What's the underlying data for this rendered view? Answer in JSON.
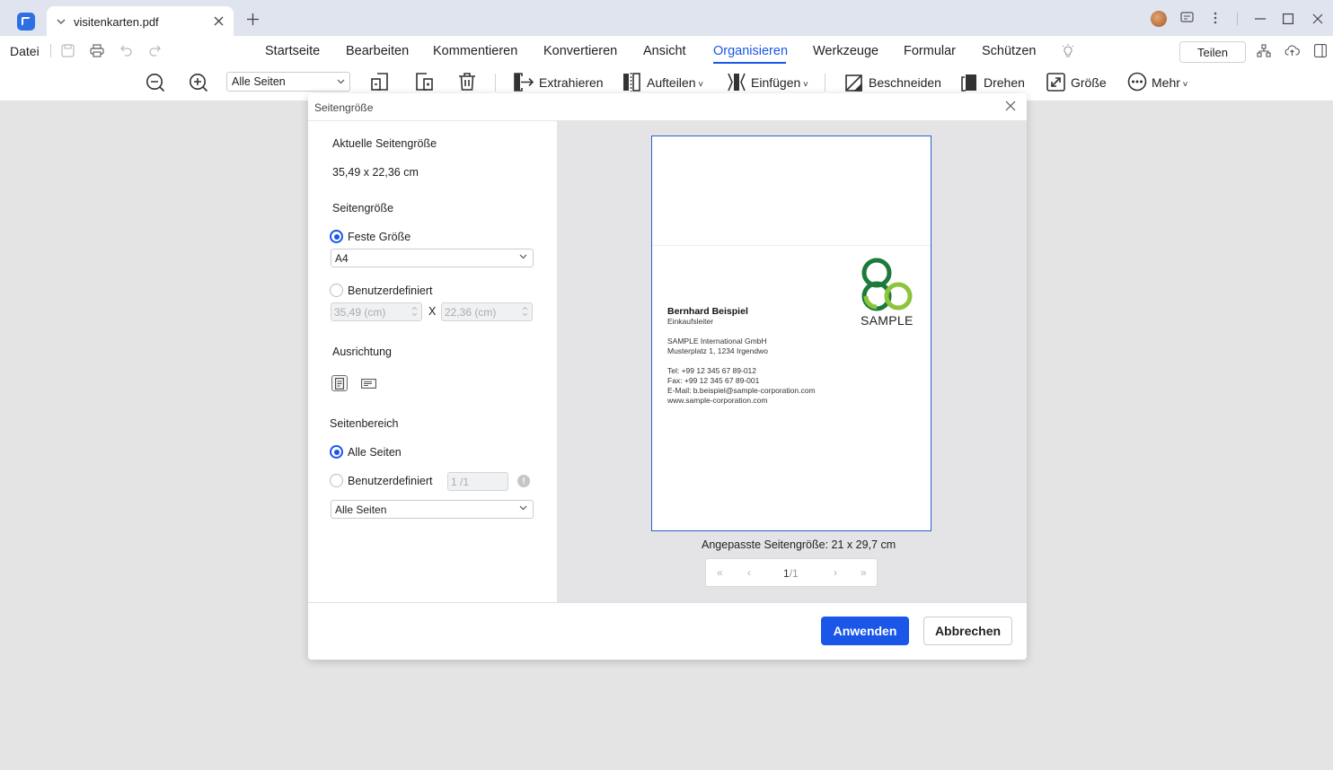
{
  "tab": {
    "title": "visitenkarten.pdf"
  },
  "menu": {
    "file": "Datei",
    "items": [
      "Startseite",
      "Bearbeiten",
      "Kommentieren",
      "Konvertieren",
      "Ansicht",
      "Organisieren",
      "Werkzeuge",
      "Formular",
      "Schützen"
    ],
    "active": "Organisieren",
    "share": "Teilen"
  },
  "toolbar": {
    "page_range": "Alle Seiten",
    "extract": "Extrahieren",
    "split": "Aufteilen",
    "insert": "Einfügen",
    "crop": "Beschneiden",
    "rotate": "Drehen",
    "size": "Größe",
    "more": "Mehr"
  },
  "dialog": {
    "title": "Seitengröße",
    "current_size_heading": "Aktuelle Seitengröße",
    "current_size_value": "35,49 x 22,36 cm",
    "page_size_heading": "Seitengröße",
    "fixed_size_label": "Feste Größe",
    "fixed_size_value": "A4",
    "custom_label": "Benutzerdefiniert",
    "custom_width": "35,49 (cm)",
    "custom_height": "22,36 (cm)",
    "custom_x": "X",
    "orientation_heading": "Ausrichtung",
    "range_heading": "Seitenbereich",
    "all_pages_label": "Alle Seiten",
    "range_custom_label": "Benutzerdefiniert",
    "range_custom_value": "1 /1",
    "range_select_value": "Alle Seiten",
    "preview_size_label": "Angepasste Seitengröße: 21 x 29,7 cm",
    "pager_current": "1",
    "pager_total": "/1",
    "apply": "Anwenden",
    "cancel": "Abbrechen"
  },
  "card": {
    "name": "Bernhard Beispiel",
    "role": "Einkaufsleiter",
    "company": "SAMPLE International GmbH",
    "address": "Musterplatz 1, 1234 Irgendwo",
    "tel": "Tel: +99 12 345 67 89-012",
    "fax": "Fax:  +99 12 345 67 89-001",
    "email": "E-Mail: b.beispiel@sample-corporation.com",
    "web": "www.sample-corporation.com",
    "logo_text": "SAMPLE"
  },
  "colors": {
    "accent": "#1a56e8",
    "logo_dark": "#1c7a3a",
    "logo_light": "#8cc43c"
  }
}
